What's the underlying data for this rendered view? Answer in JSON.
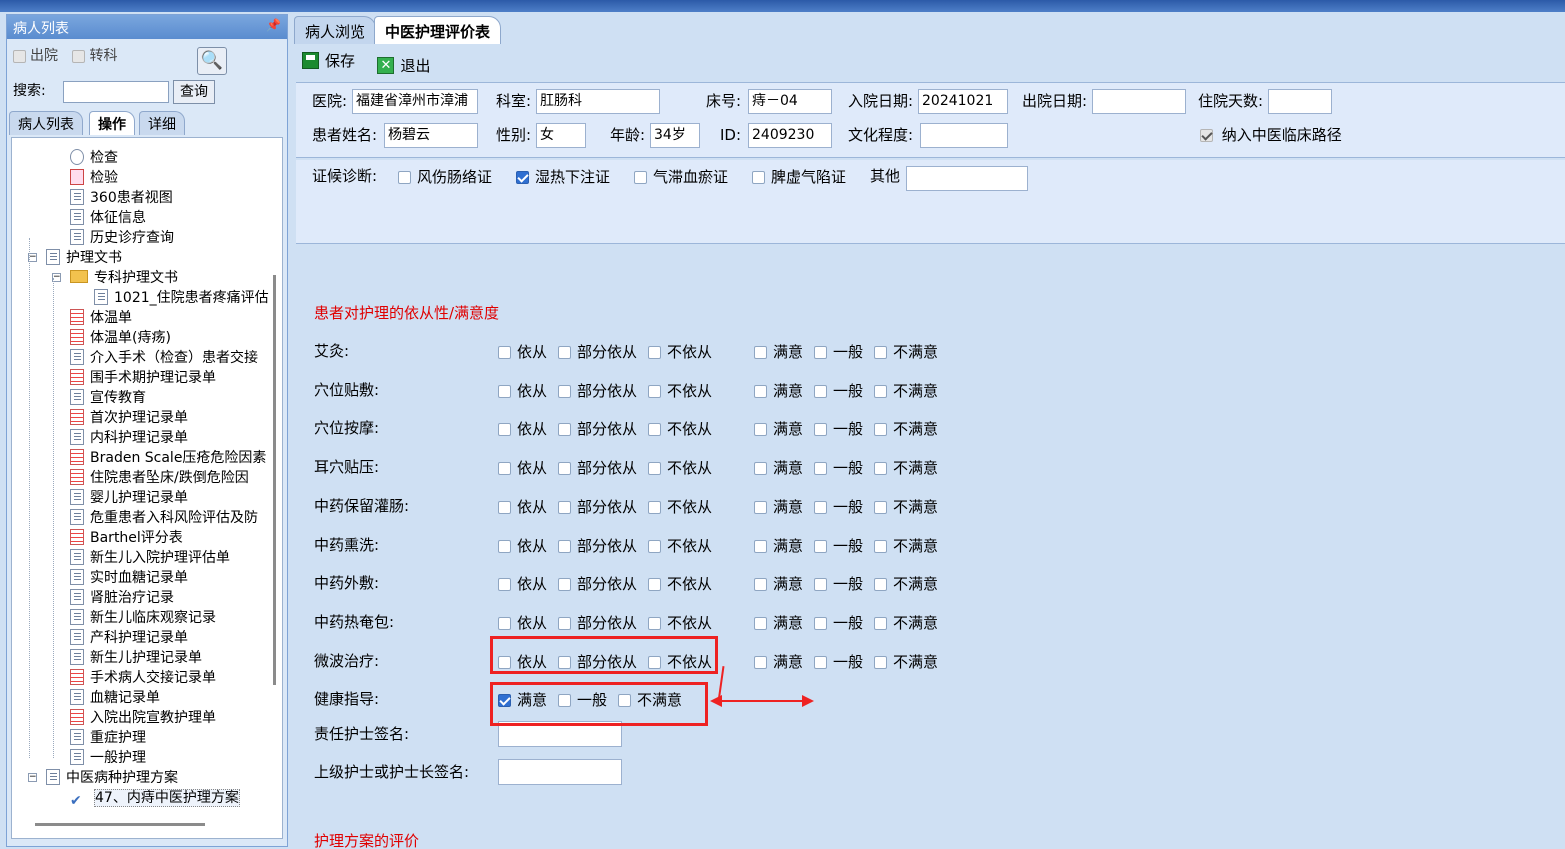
{
  "left_panel": {
    "title": "病人列表",
    "pin": "ᵖ",
    "discharged_label": "出院",
    "transfer_label": "转科",
    "search_label": "搜索:",
    "search_button": "查询",
    "tabs": [
      "病人列表",
      "操作",
      "详细"
    ],
    "tree": [
      {
        "label": "检查",
        "icon": "magnifier-icon"
      },
      {
        "label": "检验",
        "icon": "test-icon"
      },
      {
        "label": "360患者视图",
        "icon": "doc-icon"
      },
      {
        "label": "体征信息",
        "icon": "doc-icon"
      },
      {
        "label": "历史诊疗查询",
        "icon": "doc-icon"
      },
      {
        "label": "护理文书",
        "icon": "doc-icon"
      },
      {
        "label": "专科护理文书",
        "icon": "folder-icon"
      },
      {
        "label": "1021_住院患者疼痛评估",
        "icon": "doc-icon"
      },
      {
        "label": "体温单",
        "icon": "chart-icon"
      },
      {
        "label": "体温单(痔疡)",
        "icon": "chart-icon"
      },
      {
        "label": "介入手术（检查）患者交接",
        "icon": "doc-icon"
      },
      {
        "label": "围手术期护理记录单",
        "icon": "chart-icon"
      },
      {
        "label": "宣传教育",
        "icon": "doc-icon"
      },
      {
        "label": "首次护理记录单",
        "icon": "chart-icon"
      },
      {
        "label": "内科护理记录单",
        "icon": "doc-icon"
      },
      {
        "label": "Braden Scale压疮危险因素",
        "icon": "chart-icon"
      },
      {
        "label": "住院患者坠床/跌倒危险因",
        "icon": "chart-icon"
      },
      {
        "label": "婴儿护理记录单",
        "icon": "doc-icon"
      },
      {
        "label": "危重患者入科风险评估及防",
        "icon": "doc-icon"
      },
      {
        "label": "Barthel评分表",
        "icon": "chart-icon"
      },
      {
        "label": "新生儿入院护理评估单",
        "icon": "doc-icon"
      },
      {
        "label": "实时血糖记录单",
        "icon": "doc-icon"
      },
      {
        "label": "肾脏治疗记录",
        "icon": "doc-icon"
      },
      {
        "label": "新生儿临床观察记录",
        "icon": "doc-icon"
      },
      {
        "label": "产科护理记录单",
        "icon": "doc-icon"
      },
      {
        "label": "新生儿护理记录单",
        "icon": "doc-icon"
      },
      {
        "label": "手术病人交接记录单",
        "icon": "chart-icon"
      },
      {
        "label": "血糖记录单",
        "icon": "doc-icon"
      },
      {
        "label": "入院出院宣教护理单",
        "icon": "chart-icon"
      },
      {
        "label": "重症护理",
        "icon": "doc-icon"
      },
      {
        "label": "一般护理",
        "icon": "doc-icon"
      },
      {
        "label": "中医病种护理方案",
        "icon": "doc-icon"
      },
      {
        "label": "47、内痔中医护理方案",
        "icon": "check-icon"
      }
    ]
  },
  "right_panel": {
    "tabs": [
      "病人浏览",
      "中医护理评价表"
    ],
    "toolbar": {
      "save": "保存",
      "exit": "退出"
    },
    "patient": {
      "hospital_label": "医院:",
      "hospital": "福建省漳州市漳浦",
      "dept_label": "科室:",
      "dept": "肛肠科",
      "bed_label": "床号:",
      "bed": "痔－04",
      "admit_label": "入院日期:",
      "admit": "20241021",
      "discharge_label": "出院日期:",
      "discharge": "",
      "days_label": "住院天数:",
      "days": "",
      "name_label": "患者姓名:",
      "name": "杨碧云",
      "sex_label": "性别:",
      "sex": "女",
      "age_label": "年龄:",
      "age": "34岁",
      "id_label": "ID:",
      "id": "2409230",
      "edu_label": "文化程度:",
      "edu": "",
      "pathway_label": "纳入中医临床路径"
    },
    "diagnosis": {
      "label": "证候诊断:",
      "options": [
        {
          "label": "风伤肠络证",
          "checked": false
        },
        {
          "label": "湿热下注证",
          "checked": true
        },
        {
          "label": "气滞血瘀证",
          "checked": false
        },
        {
          "label": "脾虚气陷证",
          "checked": false
        }
      ],
      "other_label": "其他",
      "other_value": ""
    },
    "compliance": {
      "title": "患者对护理的依从性/满意度",
      "compliance_options": [
        "依从",
        "部分依从",
        "不依从"
      ],
      "satisfaction_options": [
        "满意",
        "一般",
        "不满意"
      ],
      "rows": [
        "艾灸:",
        "穴位贴敷:",
        "穴位按摩:",
        "耳穴贴压:",
        "中药保留灌肠:",
        "中药熏洗:",
        "中药外敷:",
        "中药热奄包:",
        "微波治疗:"
      ],
      "health_label": "健康指导:",
      "health_options": [
        {
          "label": "满意",
          "checked": true
        },
        {
          "label": "一般",
          "checked": false
        },
        {
          "label": "不满意",
          "checked": false
        }
      ],
      "nurse_sign_label": "责任护士签名:",
      "senior_sign_label": "上级护士或护士长签名:",
      "plan_eval_title": "护理方案的评价"
    },
    "annotation_color": "#ee2222"
  }
}
